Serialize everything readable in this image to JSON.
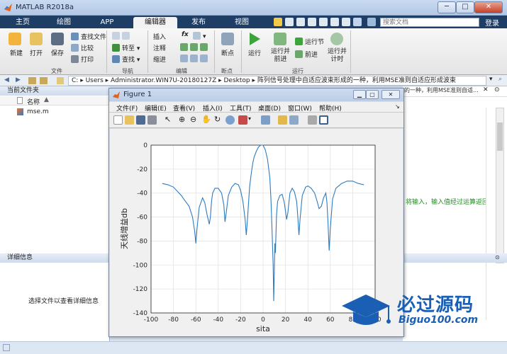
{
  "window": {
    "title": "MATLAB R2018a",
    "min_label": "─",
    "max_label": "□",
    "close_label": "✕"
  },
  "tabs": [
    "主页",
    "绘图",
    "APP",
    "编辑器",
    "发布",
    "视图"
  ],
  "active_tab": "编辑器",
  "search_placeholder": "搜索文档",
  "login_label": "登录",
  "ribbon": {
    "file": {
      "new": "新建",
      "open": "打开",
      "save": "保存",
      "find_files": "查找文件",
      "compare": "比较",
      "print": "打印",
      "section": "文件"
    },
    "navigate": {
      "goto": "转至",
      "find": "查找",
      "section": "导航"
    },
    "edit": {
      "insert": "插入",
      "comment": "注释",
      "indent": "缩进",
      "fx": "fx",
      "section": "编辑"
    },
    "breakpoints": {
      "label": "断点",
      "section": "断点"
    },
    "run": {
      "run": "运行",
      "run_advance": "运行并\n前进",
      "run_section": "运行节",
      "advance": "前进",
      "run_time": "运行并\n计时",
      "section": "运行"
    }
  },
  "address": {
    "segments": [
      "C:",
      "Users",
      "Administrator.WIN7U-20180127Z",
      "Desktop",
      "阵列信号处理中自适应波束形成的一种，利用MSE准则自适应形成波束"
    ]
  },
  "left_panel": {
    "title": "当前文件夹",
    "column_name": "名称",
    "files": [
      "mse.m"
    ],
    "detail_title": "详细信息",
    "detail_hint": "选择文件以查看详细信息"
  },
  "background_text": {
    "path_tail": "的一种，利用MSE准则自适...",
    "code_fragment": "将输入，输入值经过运算返回"
  },
  "figure": {
    "title": "Figure 1",
    "menu": [
      "文件(F)",
      "编辑(E)",
      "查看(V)",
      "插入(I)",
      "工具(T)",
      "桌面(D)",
      "窗口(W)",
      "帮助(H)"
    ]
  },
  "chart_data": {
    "type": "line",
    "title": "",
    "xlabel": "sita",
    "ylabel": "天线增益db",
    "xlim": [
      -100,
      100
    ],
    "ylim": [
      -140,
      0
    ],
    "xticks": [
      -100,
      -80,
      -60,
      -40,
      -20,
      0,
      20,
      40,
      60,
      80,
      100
    ],
    "yticks": [
      0,
      -20,
      -40,
      -60,
      -80,
      -100,
      -120,
      -140
    ],
    "grid": true,
    "color": "#2e7bbf",
    "series": [
      {
        "x": [
          -90,
          -85,
          -80,
          -76,
          -73,
          -70,
          -66,
          -63,
          -61,
          -60,
          -59,
          -57,
          -54,
          -52,
          -50,
          -48,
          -47,
          -46,
          -45,
          -43,
          -40,
          -37,
          -35,
          -34,
          -33,
          -31,
          -28,
          -25,
          -22,
          -20,
          -18,
          -16,
          -15,
          -14,
          -13,
          -12,
          -11,
          -10,
          -9,
          -8,
          -6,
          -4,
          -2,
          0,
          2,
          4,
          6,
          7,
          8,
          9,
          9.5,
          10,
          10.5,
          11,
          12,
          13,
          15,
          17,
          19,
          21,
          22,
          24,
          26,
          28,
          30,
          31,
          32,
          33,
          35,
          38,
          40,
          43,
          46,
          48,
          50,
          52,
          54,
          56,
          57,
          58,
          59,
          60,
          62,
          65,
          70,
          75,
          80,
          85,
          90
        ],
        "y": [
          -32,
          -33,
          -35,
          -39,
          -42,
          -46,
          -51,
          -60,
          -72,
          -82,
          -70,
          -52,
          -44,
          -48,
          -58,
          -66,
          -60,
          -47,
          -40,
          -36,
          -36,
          -40,
          -50,
          -64,
          -57,
          -42,
          -35,
          -32,
          -33,
          -38,
          -47,
          -62,
          -75,
          -63,
          -48,
          -35,
          -27,
          -20,
          -14,
          -10,
          -5,
          -1.5,
          0,
          0,
          -4,
          -12,
          -27,
          -45,
          -70,
          -100,
          -130,
          -108,
          -82,
          -90,
          -58,
          -47,
          -42,
          -41,
          -48,
          -62,
          -57,
          -40,
          -36,
          -39,
          -47,
          -60,
          -75,
          -62,
          -42,
          -35,
          -34,
          -36,
          -40,
          -46,
          -53,
          -51,
          -44,
          -40,
          -48,
          -65,
          -88,
          -70,
          -45,
          -36,
          -32,
          -30,
          -30,
          -32,
          -33
        ]
      }
    ]
  },
  "watermark": {
    "brand": "必过源码",
    "site": "Biguo100.com"
  },
  "colors": {
    "titlebar": "#c3d5ee",
    "tabs_bg": "#1e3e66",
    "ribbon_bg": "#eeeeee",
    "plot_line": "#2e7bbf"
  }
}
